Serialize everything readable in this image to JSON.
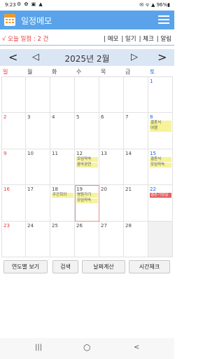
{
  "status": {
    "time": "9:23",
    "left_icons": "⚙ ✿ ▣ ▲",
    "right": "✉ ᯤ ▲ 96%▮"
  },
  "app": {
    "title": "일정메모",
    "menu_icon": "menu-icon"
  },
  "subbar": {
    "today": "√ 오늘 일정 : 2 건",
    "links": [
      "| 메모",
      "| 일기",
      "| 체크",
      "| 알림"
    ]
  },
  "nav": {
    "first": "<",
    "prev": "◁",
    "month": "2025년 2월",
    "next": "▷",
    "last": ">"
  },
  "weekdays": [
    "일",
    "월",
    "화",
    "수",
    "목",
    "금",
    "토"
  ],
  "colors": {
    "sunday": "#e53935",
    "saturday": "#1e63d6",
    "event": "#f6f39a",
    "event_red": "#e86060",
    "appbar": "#5aa3ea"
  },
  "weeks": [
    [
      {
        "d": ""
      },
      {
        "d": ""
      },
      {
        "d": ""
      },
      {
        "d": ""
      },
      {
        "d": ""
      },
      {
        "d": ""
      },
      {
        "d": "1"
      }
    ],
    [
      {
        "d": "2"
      },
      {
        "d": "3"
      },
      {
        "d": "4"
      },
      {
        "d": "5"
      },
      {
        "d": "6"
      },
      {
        "d": "7"
      },
      {
        "d": "8",
        "ev": [
          "결혼식",
          "여행"
        ]
      }
    ],
    [
      {
        "d": "9"
      },
      {
        "d": "10"
      },
      {
        "d": "11"
      },
      {
        "d": "12",
        "ev": [
          "모임약속",
          "음악공연"
        ]
      },
      {
        "d": "13"
      },
      {
        "d": "14"
      },
      {
        "d": "15",
        "ev": [
          "결혼식",
          "모임약속"
        ]
      }
    ],
    [
      {
        "d": "16"
      },
      {
        "d": "17"
      },
      {
        "d": "18",
        "ev": [
          "주간회의"
        ]
      },
      {
        "d": "19",
        "ev": [
          "병원가기",
          "모임약속"
        ],
        "sel": true
      },
      {
        "d": "20"
      },
      {
        "d": "21"
      },
      {
        "d": "22",
        "ev": [
          "결혼기념일"
        ],
        "red": true
      }
    ],
    [
      {
        "d": "23"
      },
      {
        "d": "24"
      },
      {
        "d": "25"
      },
      {
        "d": "26"
      },
      {
        "d": "27"
      },
      {
        "d": "28"
      },
      {
        "d": "",
        "empty": true
      }
    ]
  ],
  "buttons": [
    "연도별 보기",
    "검색",
    "날짜계산",
    "시간체크"
  ],
  "sysnav": {
    "recent": "|||",
    "home": "○",
    "back": "<"
  }
}
